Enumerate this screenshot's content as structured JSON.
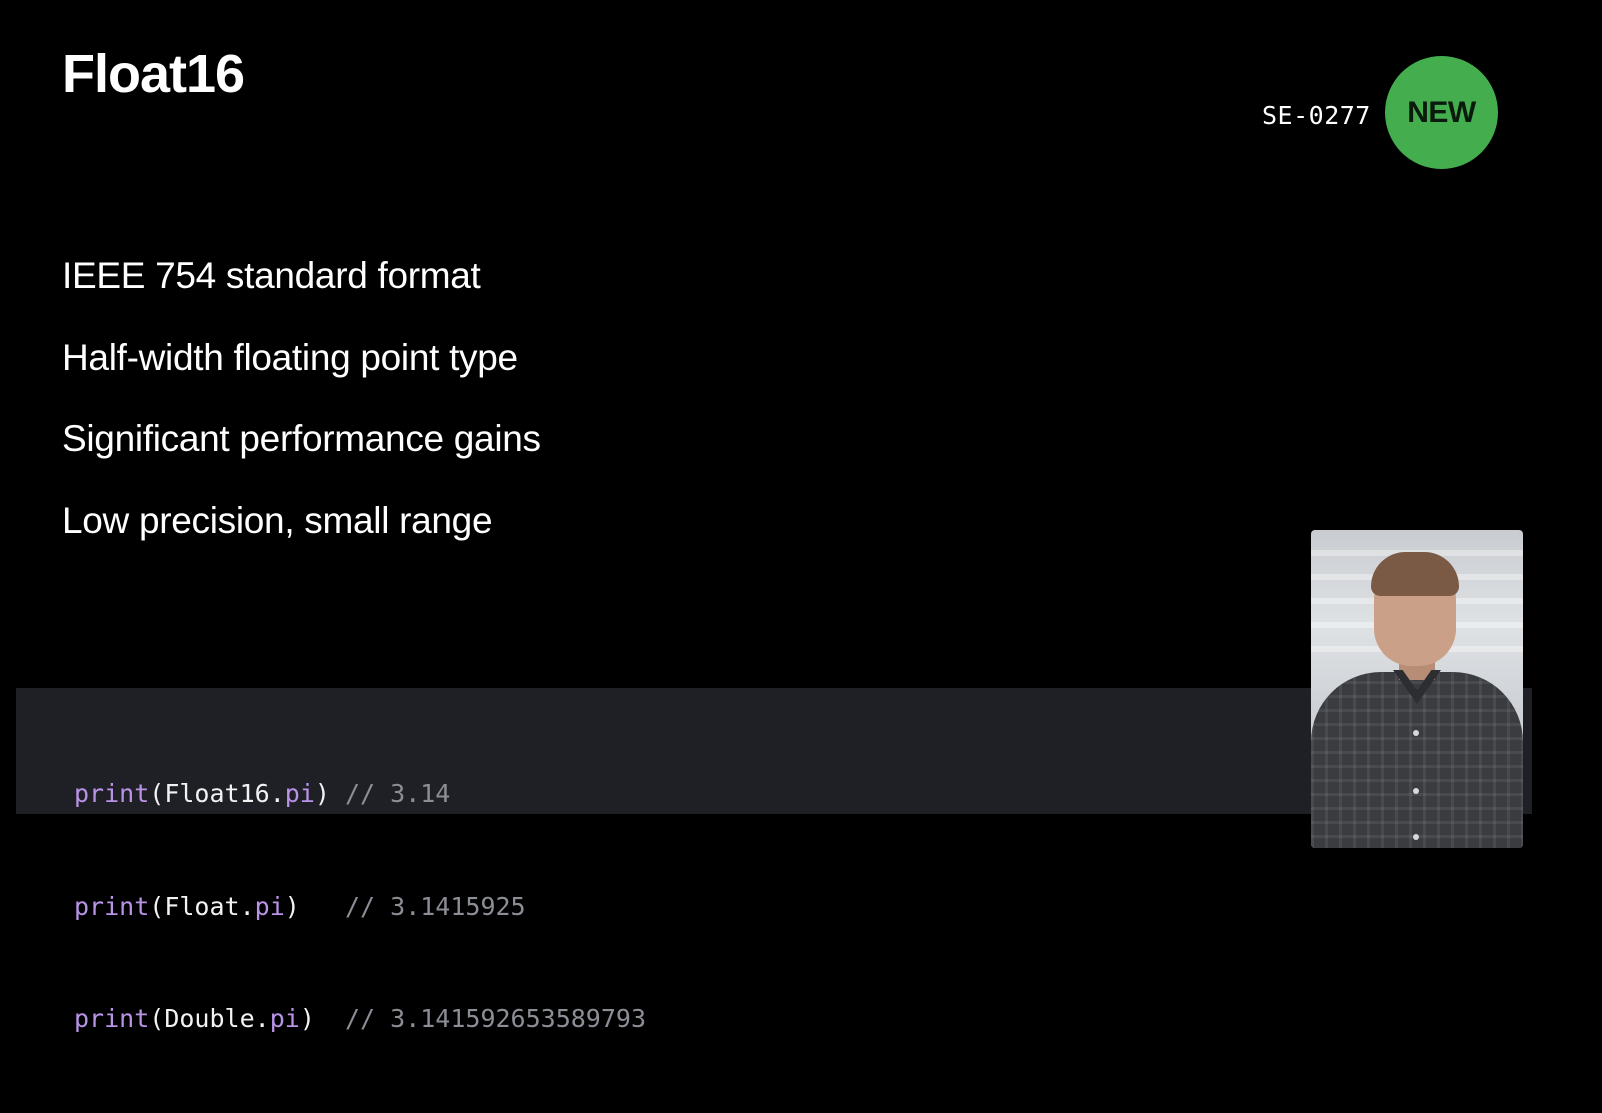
{
  "slide": {
    "title": "Float16",
    "proposal_id": "SE-0277",
    "badge": "NEW",
    "badge_color": "#44ad4e",
    "bullets": [
      "IEEE 754 standard format",
      "Half-width floating point type",
      "Significant performance gains",
      "Low precision, small range"
    ]
  },
  "code": {
    "lines": [
      {
        "fn": "print",
        "open": "(",
        "type": "Float16",
        "dot": ".",
        "prop": "pi",
        "close": ")",
        "pad": " ",
        "comment": "// 3.14"
      },
      {
        "fn": "print",
        "open": "(",
        "type": "Float",
        "dot": ".",
        "prop": "pi",
        "close": ")",
        "pad": "   ",
        "comment": "// 3.1415925"
      },
      {
        "fn": "print",
        "open": "(",
        "type": "Double",
        "dot": ".",
        "prop": "pi",
        "close": ")",
        "pad": "  ",
        "comment": "// 3.141592653589793"
      }
    ],
    "keyword_color": "#b993e8",
    "comment_color": "#8c8e96",
    "background": "#1f2026"
  },
  "presenter": {
    "icon": "presenter-video-icon"
  }
}
